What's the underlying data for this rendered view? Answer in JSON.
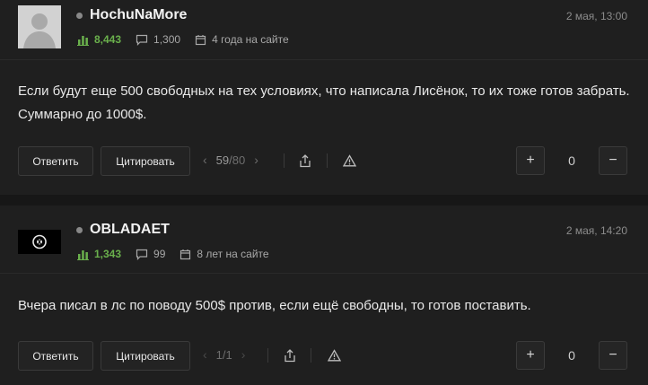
{
  "icons": {
    "reputation": "bar-chart-icon",
    "messages": "message-icon",
    "tenure": "calendar-icon",
    "prev": "chevron-left-icon",
    "next": "chevron-right-icon",
    "share": "share-icon",
    "report": "warning-icon"
  },
  "colors": {
    "reputation": "#6ab04c",
    "background": "#1f1f1f",
    "page": "#191919"
  },
  "posts": [
    {
      "username": "HochuNaMore",
      "date": "2 мая, 13:00",
      "reputation": "8,443",
      "messages": "1,300",
      "tenure": "4 года на сайте",
      "text": "Если будут еще 500 свободных на тех условиях, что написала Лисёнок, то их тоже готов забрать. Суммарно до 1000$.",
      "reply": "Ответить",
      "quote": "Цитировать",
      "page_current": "59",
      "page_sep": "/",
      "page_total": "80",
      "score": "0",
      "plus": "+",
      "minus": "−"
    },
    {
      "username": "OBLADAET",
      "date": "2 мая, 14:20",
      "reputation": "1,343",
      "messages": "99",
      "tenure": "8 лет на сайте",
      "text": "Вчера писал в лс по поводу 500$ против, если ещё свободны, то готов поставить.",
      "reply": "Ответить",
      "quote": "Цитировать",
      "page_current": "1",
      "page_sep": "/",
      "page_total": "1",
      "score": "0",
      "plus": "+",
      "minus": "−"
    }
  ]
}
